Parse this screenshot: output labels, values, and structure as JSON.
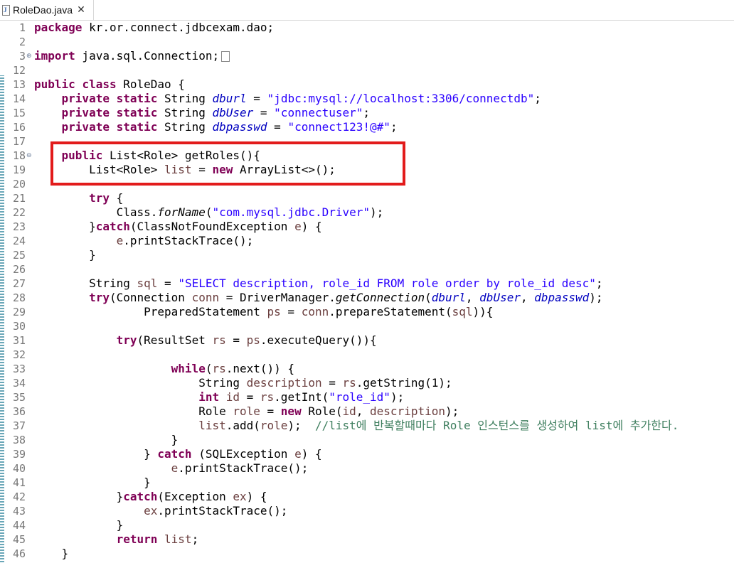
{
  "tab": {
    "label": "RoleDao.java",
    "close": "✕",
    "icon": "java-file-icon"
  },
  "annotation": {
    "color": "#e21b1b"
  },
  "lines": [
    {
      "n": "1",
      "tokens": [
        [
          "kw",
          "package"
        ],
        [
          "p",
          " kr.or.connect.jdbcexam.dao;"
        ]
      ]
    },
    {
      "n": "2",
      "tokens": []
    },
    {
      "n": "3",
      "fold": "⊕",
      "tokens": [
        [
          "kw",
          "import"
        ],
        [
          "p",
          " java.sql.Connection;"
        ]
      ],
      "collapsed": true
    },
    {
      "n": "12",
      "tokens": []
    },
    {
      "n": "13",
      "tokens": [
        [
          "kw",
          "public"
        ],
        [
          "p",
          " "
        ],
        [
          "kw",
          "class"
        ],
        [
          "p",
          " RoleDao {"
        ]
      ]
    },
    {
      "n": "14",
      "tokens": [
        [
          "p",
          "    "
        ],
        [
          "kw",
          "private"
        ],
        [
          "p",
          " "
        ],
        [
          "kw",
          "static"
        ],
        [
          "p",
          " String "
        ],
        [
          "fld",
          "dburl"
        ],
        [
          "p",
          " = "
        ],
        [
          "str",
          "\"jdbc:mysql://localhost:3306/connectdb\""
        ],
        [
          "p",
          ";"
        ]
      ]
    },
    {
      "n": "15",
      "tokens": [
        [
          "p",
          "    "
        ],
        [
          "kw",
          "private"
        ],
        [
          "p",
          " "
        ],
        [
          "kw",
          "static"
        ],
        [
          "p",
          " String "
        ],
        [
          "fld",
          "dbUser"
        ],
        [
          "p",
          " = "
        ],
        [
          "str",
          "\"connectuser\""
        ],
        [
          "p",
          ";"
        ]
      ]
    },
    {
      "n": "16",
      "tokens": [
        [
          "p",
          "    "
        ],
        [
          "kw",
          "private"
        ],
        [
          "p",
          " "
        ],
        [
          "kw",
          "static"
        ],
        [
          "p",
          " String "
        ],
        [
          "fld",
          "dbpasswd"
        ],
        [
          "p",
          " = "
        ],
        [
          "str",
          "\"connect123!@#\""
        ],
        [
          "p",
          ";"
        ]
      ]
    },
    {
      "n": "17",
      "tokens": []
    },
    {
      "n": "18",
      "fold": "⊖",
      "tokens": [
        [
          "p",
          "    "
        ],
        [
          "kw",
          "public"
        ],
        [
          "p",
          " List<Role> getRoles(){"
        ]
      ]
    },
    {
      "n": "19",
      "tokens": [
        [
          "p",
          "        List<Role> "
        ],
        [
          "var",
          "list"
        ],
        [
          "p",
          " = "
        ],
        [
          "kw",
          "new"
        ],
        [
          "p",
          " ArrayList<>();"
        ]
      ]
    },
    {
      "n": "20",
      "tokens": []
    },
    {
      "n": "21",
      "tokens": [
        [
          "p",
          "        "
        ],
        [
          "kw",
          "try"
        ],
        [
          "p",
          " {"
        ]
      ]
    },
    {
      "n": "22",
      "tokens": [
        [
          "p",
          "            Class."
        ],
        [
          "sm",
          "forName"
        ],
        [
          "p",
          "("
        ],
        [
          "str",
          "\"com.mysql.jdbc.Driver\""
        ],
        [
          "p",
          ");"
        ]
      ]
    },
    {
      "n": "23",
      "tokens": [
        [
          "p",
          "        }"
        ],
        [
          "kw",
          "catch"
        ],
        [
          "p",
          "(ClassNotFoundException "
        ],
        [
          "var",
          "e"
        ],
        [
          "p",
          ") {"
        ]
      ]
    },
    {
      "n": "24",
      "tokens": [
        [
          "p",
          "            "
        ],
        [
          "var",
          "e"
        ],
        [
          "p",
          ".printStackTrace();"
        ]
      ]
    },
    {
      "n": "25",
      "tokens": [
        [
          "p",
          "        }"
        ]
      ]
    },
    {
      "n": "26",
      "tokens": []
    },
    {
      "n": "27",
      "tokens": [
        [
          "p",
          "        String "
        ],
        [
          "var",
          "sql"
        ],
        [
          "p",
          " = "
        ],
        [
          "str",
          "\"SELECT description, role_id FROM role order by role_id desc\""
        ],
        [
          "p",
          ";"
        ]
      ]
    },
    {
      "n": "28",
      "tokens": [
        [
          "p",
          "        "
        ],
        [
          "kw",
          "try"
        ],
        [
          "p",
          "(Connection "
        ],
        [
          "var",
          "conn"
        ],
        [
          "p",
          " = DriverManager."
        ],
        [
          "sm",
          "getConnection"
        ],
        [
          "p",
          "("
        ],
        [
          "fld",
          "dburl"
        ],
        [
          "p",
          ", "
        ],
        [
          "fld",
          "dbUser"
        ],
        [
          "p",
          ", "
        ],
        [
          "fld",
          "dbpasswd"
        ],
        [
          "p",
          ");"
        ]
      ]
    },
    {
      "n": "29",
      "tokens": [
        [
          "p",
          "                PreparedStatement "
        ],
        [
          "var",
          "ps"
        ],
        [
          "p",
          " = "
        ],
        [
          "var",
          "conn"
        ],
        [
          "p",
          ".prepareStatement("
        ],
        [
          "var",
          "sql"
        ],
        [
          "p",
          ")){"
        ]
      ]
    },
    {
      "n": "30",
      "tokens": []
    },
    {
      "n": "31",
      "tokens": [
        [
          "p",
          "            "
        ],
        [
          "kw",
          "try"
        ],
        [
          "p",
          "(ResultSet "
        ],
        [
          "var",
          "rs"
        ],
        [
          "p",
          " = "
        ],
        [
          "var",
          "ps"
        ],
        [
          "p",
          ".executeQuery()){"
        ]
      ]
    },
    {
      "n": "32",
      "tokens": []
    },
    {
      "n": "33",
      "tokens": [
        [
          "p",
          "                    "
        ],
        [
          "kw",
          "while"
        ],
        [
          "p",
          "("
        ],
        [
          "var",
          "rs"
        ],
        [
          "p",
          ".next()) {"
        ]
      ]
    },
    {
      "n": "34",
      "tokens": [
        [
          "p",
          "                        String "
        ],
        [
          "var",
          "description"
        ],
        [
          "p",
          " = "
        ],
        [
          "var",
          "rs"
        ],
        [
          "p",
          ".getString(1);"
        ]
      ]
    },
    {
      "n": "35",
      "tokens": [
        [
          "p",
          "                        "
        ],
        [
          "kw",
          "int"
        ],
        [
          "p",
          " "
        ],
        [
          "var",
          "id"
        ],
        [
          "p",
          " = "
        ],
        [
          "var",
          "rs"
        ],
        [
          "p",
          ".getInt("
        ],
        [
          "str",
          "\"role_id\""
        ],
        [
          "p",
          ");"
        ]
      ]
    },
    {
      "n": "36",
      "tokens": [
        [
          "p",
          "                        Role "
        ],
        [
          "var",
          "role"
        ],
        [
          "p",
          " = "
        ],
        [
          "kw",
          "new"
        ],
        [
          "p",
          " Role("
        ],
        [
          "var",
          "id"
        ],
        [
          "p",
          ", "
        ],
        [
          "var",
          "description"
        ],
        [
          "p",
          ");"
        ]
      ]
    },
    {
      "n": "37",
      "tokens": [
        [
          "p",
          "                        "
        ],
        [
          "var",
          "list"
        ],
        [
          "p",
          ".add("
        ],
        [
          "var",
          "role"
        ],
        [
          "p",
          ");  "
        ],
        [
          "cmt",
          "//list에 반복할때마다 Role 인스턴스를 생성하여 list에 추가한다."
        ]
      ]
    },
    {
      "n": "38",
      "tokens": [
        [
          "p",
          "                    }"
        ]
      ]
    },
    {
      "n": "39",
      "tokens": [
        [
          "p",
          "                } "
        ],
        [
          "kw",
          "catch"
        ],
        [
          "p",
          " (SQLException "
        ],
        [
          "var",
          "e"
        ],
        [
          "p",
          ") {"
        ]
      ]
    },
    {
      "n": "40",
      "tokens": [
        [
          "p",
          "                    "
        ],
        [
          "var",
          "e"
        ],
        [
          "p",
          ".printStackTrace();"
        ]
      ]
    },
    {
      "n": "41",
      "tokens": [
        [
          "p",
          "                }"
        ]
      ]
    },
    {
      "n": "42",
      "tokens": [
        [
          "p",
          "            }"
        ],
        [
          "kw",
          "catch"
        ],
        [
          "p",
          "(Exception "
        ],
        [
          "var",
          "ex"
        ],
        [
          "p",
          ") {"
        ]
      ]
    },
    {
      "n": "43",
      "tokens": [
        [
          "p",
          "                "
        ],
        [
          "var",
          "ex"
        ],
        [
          "p",
          ".printStackTrace();"
        ]
      ]
    },
    {
      "n": "44",
      "tokens": [
        [
          "p",
          "            }"
        ]
      ]
    },
    {
      "n": "45",
      "tokens": [
        [
          "p",
          "            "
        ],
        [
          "kw",
          "return"
        ],
        [
          "p",
          " "
        ],
        [
          "var",
          "list"
        ],
        [
          "p",
          ";"
        ]
      ]
    },
    {
      "n": "46",
      "tokens": [
        [
          "p",
          "    }"
        ]
      ]
    }
  ]
}
